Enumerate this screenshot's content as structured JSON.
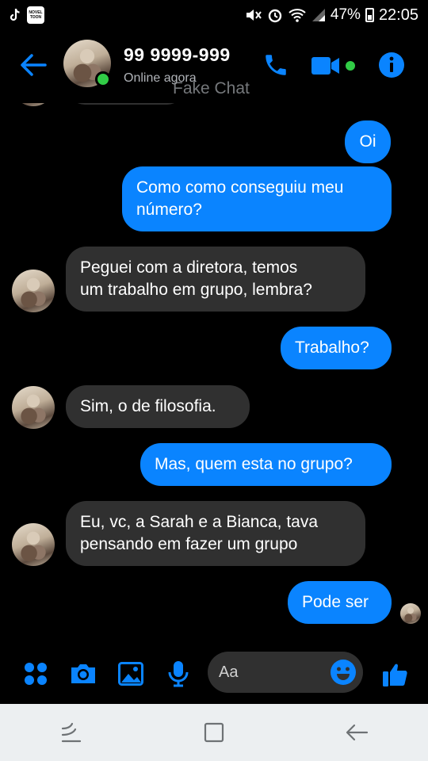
{
  "status_bar": {
    "app_badge": "NOVEL TOON",
    "battery": "47%",
    "time": "22:05",
    "battery_level": 0.47
  },
  "header": {
    "contact_name": "99 9999-999",
    "status": "Online agora",
    "watermark": "Fake Chat"
  },
  "messages": [
    {
      "dir": "out",
      "text": "Oi"
    },
    {
      "dir": "out",
      "text": "Como como conseguiu meu\nnúmero?"
    },
    {
      "dir": "in",
      "text": "Peguei com a diretora, temos\num trabalho em grupo, lembra?"
    },
    {
      "dir": "out",
      "text": "Trabalho?"
    },
    {
      "dir": "in",
      "text": "Sim, o de filosofia."
    },
    {
      "dir": "out",
      "text": "Mas, quem esta no grupo?"
    },
    {
      "dir": "in",
      "text": "Eu, vc, a Sarah e a Bianca, tava\npensando em fazer um grupo"
    },
    {
      "dir": "out",
      "text": "Pode ser"
    }
  ],
  "composer": {
    "placeholder": "Aa"
  },
  "colors": {
    "accent": "#0a84ff",
    "incoming_bubble": "#303030",
    "online": "#31cc46"
  }
}
